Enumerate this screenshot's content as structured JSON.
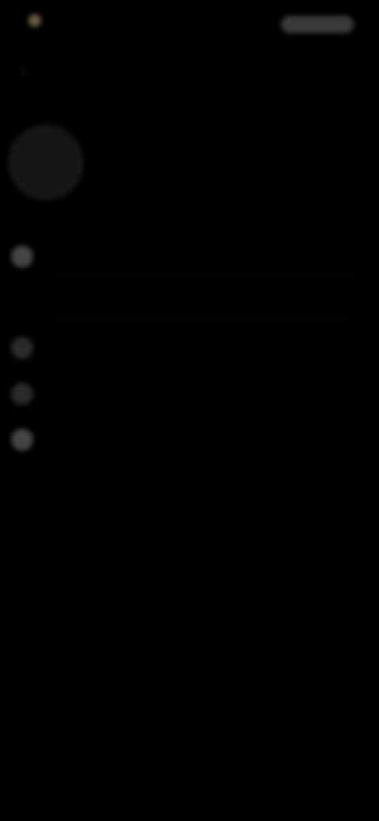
{
  "status_bar": {
    "time": "",
    "indicator": ""
  },
  "header": {
    "back_icon": "arrow-left-icon"
  },
  "profile": {
    "avatar_icon": "avatar"
  },
  "menu": {
    "items": [
      {
        "label": "",
        "icon": "circle-icon"
      },
      {
        "label": "",
        "icon": ""
      },
      {
        "label": "",
        "icon": "circle-icon"
      },
      {
        "label": "",
        "icon": "circle-icon"
      },
      {
        "label": "",
        "icon": "circle-icon"
      }
    ]
  },
  "colors": {
    "background": "#000000",
    "accent": "#6b5a3e"
  }
}
